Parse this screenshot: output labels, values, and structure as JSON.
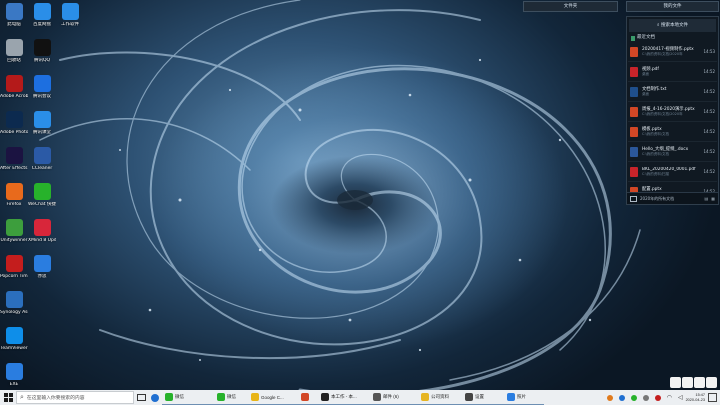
{
  "desktop": {
    "icons": [
      {
        "label": "此电脑",
        "icon": "computer-icon",
        "color": "#3a78c4"
      },
      {
        "label": "百度网盘",
        "icon": "baidu-netdisk-icon",
        "color": "#2a8ee8"
      },
      {
        "label": "工作软件",
        "icon": "work-app-icon",
        "color": "#2a8ee8"
      },
      {
        "label": "回收站",
        "icon": "recycle-bin-icon",
        "color": "#9aa4ad"
      },
      {
        "label": "腾讯QQ",
        "icon": "qq-icon",
        "color": "#111111"
      },
      {
        "label": "Adobe Acrobat DC",
        "icon": "acrobat-icon",
        "color": "#b41a1a"
      },
      {
        "label": "腾讯会议",
        "icon": "tencent-meeting-icon",
        "color": "#1d6fe0"
      },
      {
        "label": "Adobe Photoshop CC 2019",
        "icon": "photoshop-icon",
        "color": "#0c2a4f"
      },
      {
        "label": "腾讯课堂",
        "icon": "tencent-classroom-icon",
        "color": "#2a8ee8"
      },
      {
        "label": "After Effects 中文版",
        "icon": "after-effects-icon",
        "color": "#1b1341"
      },
      {
        "label": "CCleaner",
        "icon": "ccleaner-icon",
        "color": "#2b5aa6"
      },
      {
        "label": "Firefox",
        "icon": "firefox-icon",
        "color": "#e86a1c"
      },
      {
        "label": "WeChat 快捷方式",
        "icon": "wechat-icon",
        "color": "#27b22b"
      },
      {
        "label": "Unitywinner",
        "icon": "unity-icon",
        "color": "#3d9e3d"
      },
      {
        "label": "XMind 8 Update",
        "icon": "xmind-icon",
        "color": "#d8263a"
      },
      {
        "label": "Popcorn Time",
        "icon": "popcorn-icon",
        "color": "#c41d1d"
      },
      {
        "label": "亦思",
        "icon": "app-icon",
        "color": "#2a7de0"
      },
      {
        "label": "Synology Assistant",
        "icon": "synology-icon",
        "color": "#2b6fbd"
      },
      {
        "label": "TeamViewer",
        "icon": "teamviewer-icon",
        "color": "#0e8ee9"
      },
      {
        "label": "EXE",
        "icon": "exe-icon",
        "color": "#2a7de0"
      }
    ]
  },
  "top_tabs": {
    "left": "文件夹",
    "right": "我的文件"
  },
  "panel": {
    "search_label": "搜索本地文件",
    "recent_label": "最近文档",
    "files": [
      {
        "name": "20200417-视频制作.pptx",
        "sub": "C:\\我的资料\\文档\\2020年",
        "time": "14:53",
        "type": "pptx",
        "color": "#d24726",
        "icon": "ppt-file-icon"
      },
      {
        "name": "视频.pdf",
        "sub": "桌面",
        "time": "14:52",
        "type": "pdf",
        "color": "#c8242a",
        "icon": "pdf-file-icon"
      },
      {
        "name": "文档制作.txt",
        "sub": "桌面",
        "time": "14:52",
        "type": "txt",
        "color": "#1f4f8c",
        "icon": "txt-file-icon"
      },
      {
        "name": "周报_4-16-2020演示.pptx",
        "sub": "C:\\我的资料\\文档\\2020年",
        "time": "14:52",
        "type": "pptx",
        "color": "#d24726",
        "icon": "ppt-file-icon"
      },
      {
        "name": "模板.pptx",
        "sub": "C:\\我的资料\\文档",
        "time": "14:52",
        "type": "pptx",
        "color": "#d24726",
        "icon": "ppt-file-icon"
      },
      {
        "name": "Hello_大纲_提纲_.docx",
        "sub": "C:\\我的资料\\文档",
        "time": "14:52",
        "type": "docx",
        "color": "#2b579a",
        "icon": "word-file-icon"
      },
      {
        "name": "BKL_20200420_0001.pdf",
        "sub": "C:\\我的资料\\扫描",
        "time": "14:52",
        "type": "pdf",
        "color": "#c8242a",
        "icon": "pdf-file-icon"
      },
      {
        "name": "配置.pptx",
        "sub": "C:\\我的资料\\文档",
        "time": "14:52",
        "type": "pptx",
        "color": "#d24726",
        "icon": "ppt-file-icon"
      }
    ],
    "footer_label": "2020年的所有文档"
  },
  "taskbar": {
    "search_placeholder": "在这里输入你要搜索的内容",
    "apps": [
      {
        "label": "微信",
        "color": "#27b22b",
        "icon": "wechat-icon"
      },
      {
        "label": "微信",
        "color": "#27b22b",
        "icon": "wechat-icon"
      },
      {
        "label": "Google C...",
        "color": "#e8b417",
        "icon": "chrome-icon"
      },
      {
        "label": "",
        "color": "#d24726",
        "icon": "powerpoint-icon"
      },
      {
        "label": "本工作 - 本...",
        "color": "#222222",
        "icon": "terminal-icon"
      },
      {
        "label": "邮件 (6)",
        "color": "#555555",
        "icon": "mail-icon"
      },
      {
        "label": "公司资料",
        "color": "#e6b422",
        "icon": "folder-icon"
      },
      {
        "label": "设置",
        "color": "#444444",
        "icon": "settings-icon"
      },
      {
        "label": "照片",
        "color": "#2a7de0",
        "icon": "photos-icon"
      }
    ],
    "time": "15:47",
    "date": "2020-04-23"
  }
}
